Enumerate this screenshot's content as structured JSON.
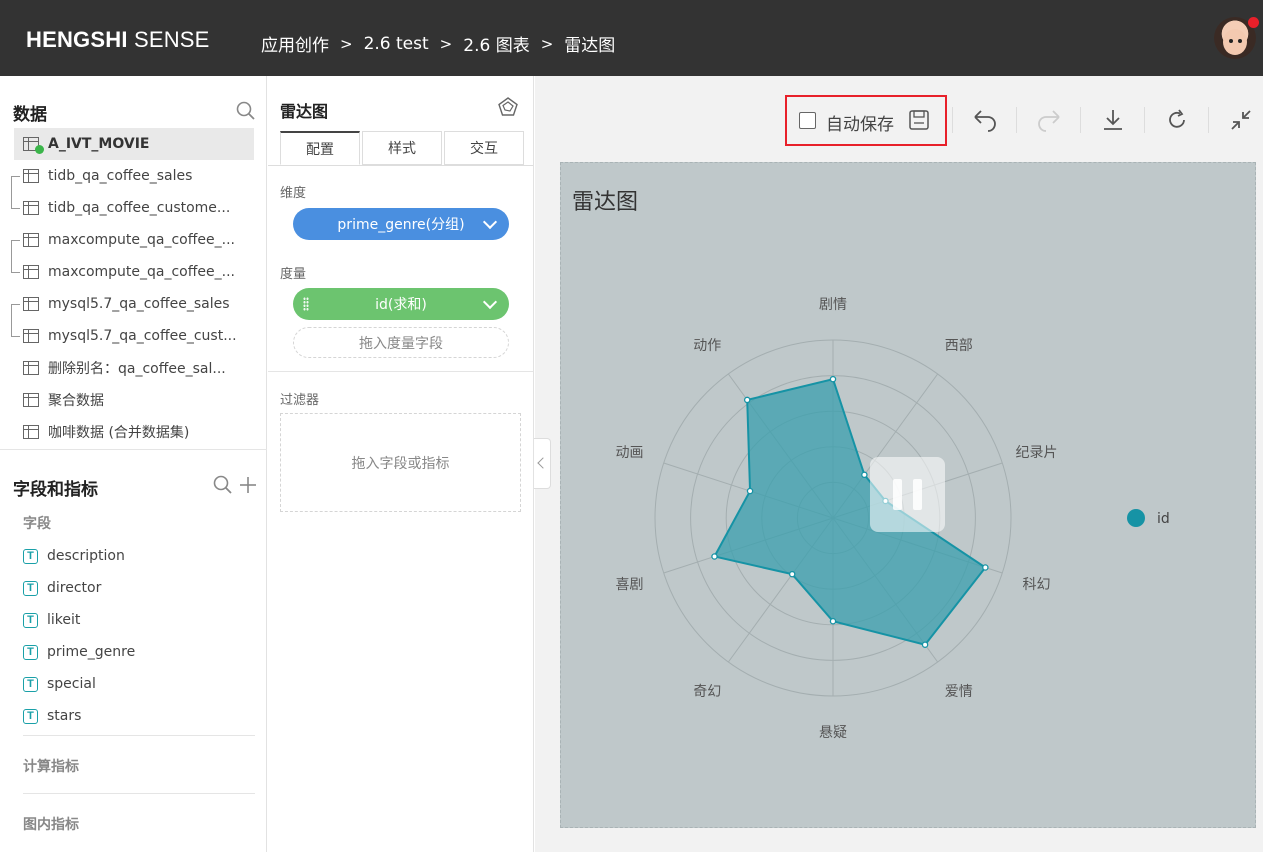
{
  "header": {
    "logo_bold": "HENGSHI",
    "logo_rest": " SENSE",
    "breadcrumbs": [
      "应用创作",
      "2.6 test",
      "2.6 图表",
      "雷达图"
    ],
    "separator": ">"
  },
  "data_panel": {
    "title": "数据",
    "datasets": [
      "A_IVT_MOVIE",
      "tidb_qa_coffee_sales",
      "tidb_qa_coffee_custome...",
      "maxcompute_qa_coffee_...",
      "maxcompute_qa_coffee_...",
      "mysql5.7_qa_coffee_sales",
      "mysql5.7_qa_coffee_cust...",
      "删除别名：qa_coffee_sal...",
      "聚合数据",
      "咖啡数据 (合并数据集)"
    ]
  },
  "fields_panel": {
    "title": "字段和指标",
    "fields_label": "字段",
    "fields": [
      "description",
      "director",
      "likeit",
      "prime_genre",
      "special",
      "stars"
    ],
    "field_type_glyph": "T",
    "calc_label": "计算指标",
    "inchart_label": "图内指标"
  },
  "config_panel": {
    "title": "雷达图",
    "tabs": [
      "配置",
      "样式",
      "交互"
    ],
    "dimension_label": "维度",
    "dimension_value": "prime_genre(分组)",
    "measure_label": "度量",
    "measure_value": "id(求和)",
    "measure_drop": "拖入度量字段",
    "filter_label": "过滤器",
    "filter_drop": "拖入字段或指标"
  },
  "toolbar": {
    "autosave_label": "自动保存",
    "autosave_checked": false
  },
  "chart_data": {
    "type": "radar",
    "title": "雷达图",
    "categories": [
      "剧情",
      "西部",
      "纪录片",
      "科幻",
      "爱情",
      "悬疑",
      "奇幻",
      "喜剧",
      "动画",
      "动作"
    ],
    "series": [
      {
        "name": "id",
        "values": [
          0.78,
          0.3,
          0.31,
          0.9,
          0.88,
          0.58,
          0.39,
          0.7,
          0.49,
          0.82
        ]
      }
    ],
    "rings": 5,
    "legend_position": "right",
    "colors": {
      "fill": "#3a9fae",
      "stroke": "#1693a5",
      "legend": "#1693a5",
      "background": "#bfc8ca"
    }
  }
}
